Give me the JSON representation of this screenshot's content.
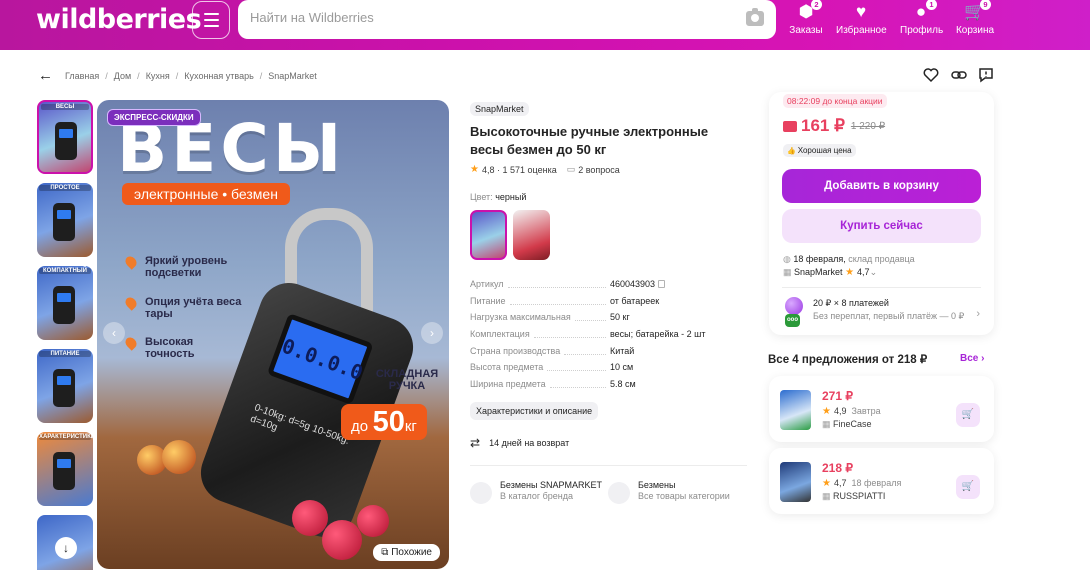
{
  "header": {
    "logo": "wildberries",
    "search_placeholder": "Найти на Wildberries",
    "nav": [
      {
        "label": "Заказы",
        "badge": "2"
      },
      {
        "label": "Избранное",
        "badge": ""
      },
      {
        "label": "Профиль",
        "badge": "1"
      },
      {
        "label": "Корзина",
        "badge": "9"
      }
    ]
  },
  "breadcrumbs": [
    "Главная",
    "Дом",
    "Кухня",
    "Кухонная утварь",
    "SnapMarket"
  ],
  "gallery": {
    "thumb_labels": [
      "ВЕСЫ",
      "ПРОСТОЕ",
      "КОМПАКТНЫЙ",
      "ПИТАНИЕ",
      "ХАРАКТЕРИСТИКИ",
      ""
    ],
    "express_badge": "ЭКСПРЕСС-СКИДКИ",
    "headline": "ВЕСЫ",
    "subtitle": "электронные • безмен",
    "features": [
      "Яркий уровень подсветки",
      "Опция учёта веса тары",
      "Высокая точность"
    ],
    "lcd": "0.0.0.0",
    "range_text": "0-10kg: d=5g 10-50kg: d=10g",
    "folding": "СКЛАДНАЯ РУЧКА",
    "kg_prefix": "до",
    "kg_value": "50",
    "kg_unit": "кг",
    "similar_label": "Похожие"
  },
  "product": {
    "brand": "SnapMarket",
    "title": "Высокоточные ручные электронные весы безмен до 50 кг",
    "rating": "4,8",
    "rating_sep": "·",
    "reviews": "1 571 оценка",
    "questions": "2 вопроса",
    "color_label": "Цвет:",
    "color_value": "черный",
    "specs": [
      {
        "k": "Артикул",
        "v": "460043903"
      },
      {
        "k": "Питание",
        "v": "от батареек"
      },
      {
        "k": "Нагрузка максимальная",
        "v": "50 кг"
      },
      {
        "k": "Комплектация",
        "v": "весы; батарейка - 2 шт"
      },
      {
        "k": "Страна производства",
        "v": "Китай"
      },
      {
        "k": "Высота предмета",
        "v": "10 см"
      },
      {
        "k": "Ширина предмета",
        "v": "5.8 см"
      }
    ],
    "chars_button": "Характеристики и описание",
    "return_text": "14 дней на возврат",
    "links": [
      {
        "title": "Безмены SNAPMARKET",
        "sub": "В каталог бренда"
      },
      {
        "title": "Безмены",
        "sub": "Все товары категории"
      }
    ]
  },
  "buy": {
    "timer": "08:22:09",
    "timer_suffix": "до конца акции",
    "price": "161 ₽",
    "old_price": "1 220 ₽",
    "good_price": "Хорошая цена",
    "add_to_cart": "Добавить в корзину",
    "buy_now": "Купить сейчас",
    "delivery_date": "18 февраля,",
    "delivery_src": "склад продавца",
    "seller": "SnapMarket",
    "seller_rating": "4,7",
    "install_title": "20 ₽ × 8 платежей",
    "install_sub": "Без переплат, первый платёж — 0 ₽",
    "install_badge": "ооо"
  },
  "offers": {
    "heading": "Все 4 предложения от 218 ₽",
    "all_label": "Все",
    "items": [
      {
        "price": "271 ₽",
        "rating": "4,9",
        "date": "Завтра",
        "seller": "FineCase"
      },
      {
        "price": "218 ₽",
        "rating": "4,7",
        "date": "18 февраля",
        "seller": "RUSSPIATTI"
      }
    ]
  },
  "colors": {
    "brand": "#cb11ab",
    "price": "#e8405f",
    "accent": "#a724d7"
  }
}
